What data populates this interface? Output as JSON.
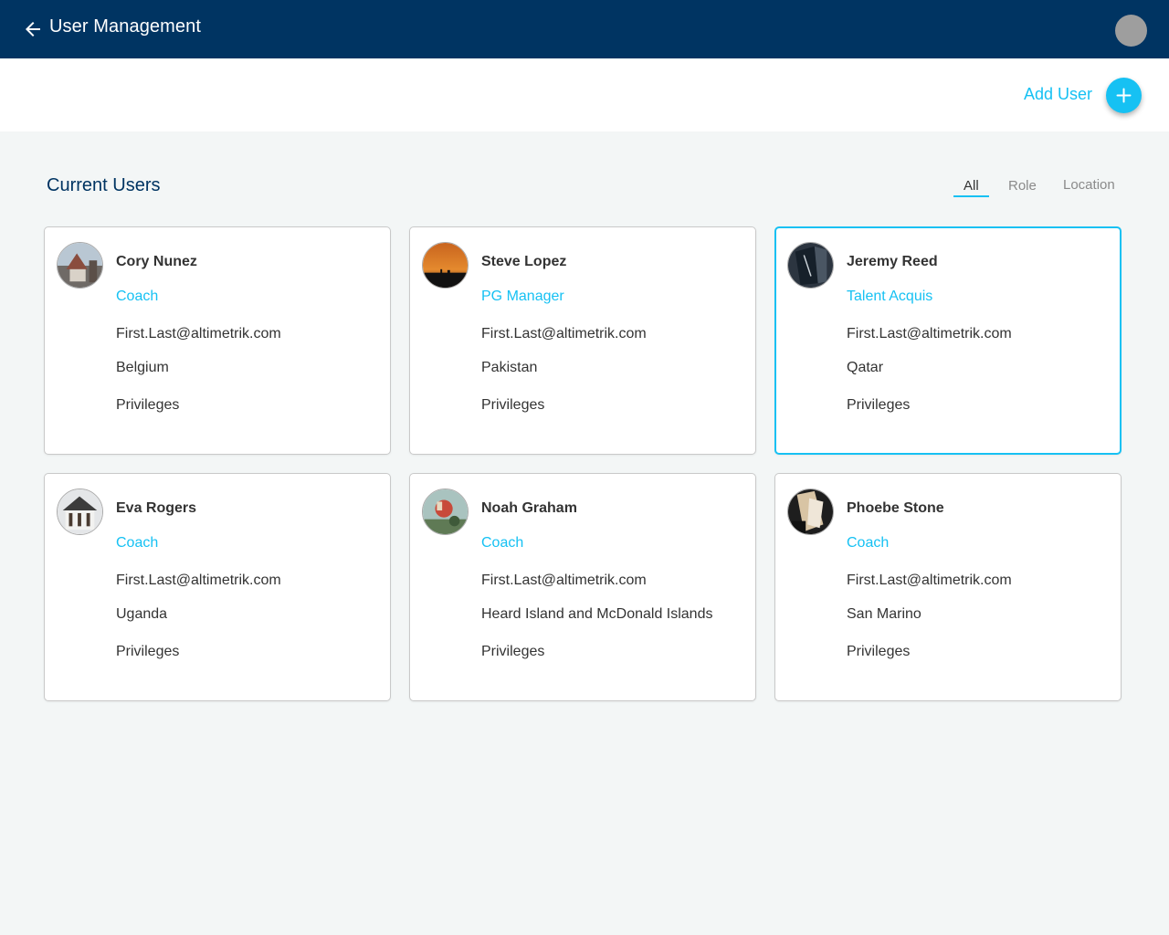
{
  "header": {
    "title": "User Management",
    "back_icon": "arrow-left-icon",
    "background": "#003462"
  },
  "actions": {
    "add_user_label": "Add User",
    "add_icon": "plus-icon",
    "accent": "#16c1f3"
  },
  "section": {
    "title": "Current Users"
  },
  "tabs": [
    {
      "label": "All",
      "active": true
    },
    {
      "label": "Role",
      "active": false
    },
    {
      "label": "Location",
      "active": false
    }
  ],
  "users": [
    {
      "name": "Cory Nunez",
      "role": "Coach",
      "email": "First.Last@altimetrik.com",
      "location": "Belgium",
      "privileges_label": "Privileges",
      "selected": false
    },
    {
      "name": "Steve Lopez",
      "role": "PG Manager",
      "email": "First.Last@altimetrik.com",
      "location": "Pakistan",
      "privileges_label": "Privileges",
      "selected": false
    },
    {
      "name": "Jeremy Reed",
      "role": "Talent Acquis",
      "email": "First.Last@altimetrik.com",
      "location": "Qatar",
      "privileges_label": "Privileges",
      "selected": true
    },
    {
      "name": "Eva Rogers",
      "role": "Coach",
      "email": "First.Last@altimetrik.com",
      "location": "Uganda",
      "privileges_label": "Privileges",
      "selected": false
    },
    {
      "name": "Noah Graham",
      "role": "Coach",
      "email": "First.Last@altimetrik.com",
      "location": "Heard Island and McDonald Islands",
      "privileges_label": "Privileges",
      "selected": false
    },
    {
      "name": "Phoebe Stone",
      "role": "Coach",
      "email": "First.Last@altimetrik.com",
      "location": "San Marino",
      "privileges_label": "Privileges",
      "selected": false
    }
  ]
}
